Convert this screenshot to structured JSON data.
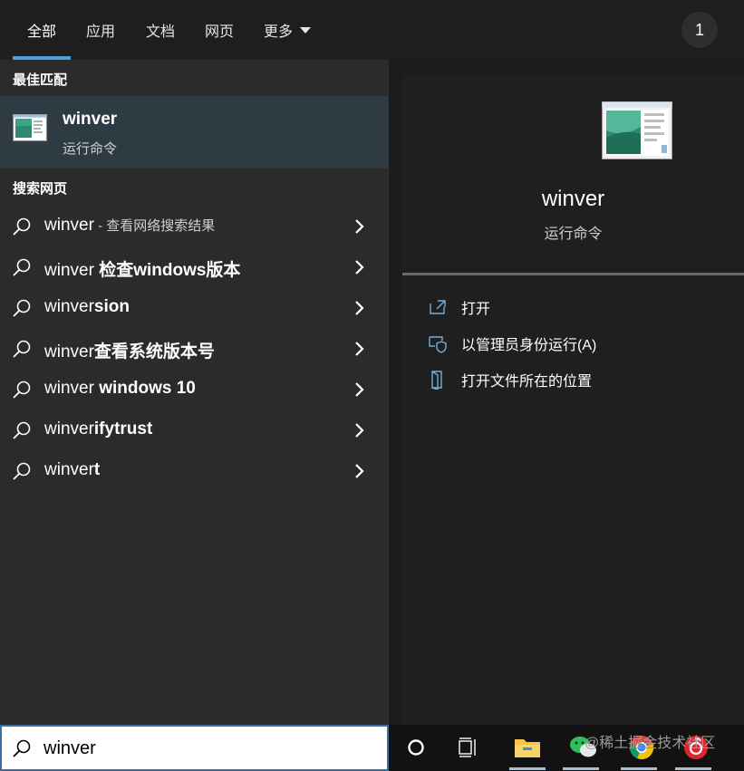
{
  "tabs": [
    {
      "label": "全部",
      "active": true
    },
    {
      "label": "应用"
    },
    {
      "label": "文档"
    },
    {
      "label": "网页"
    },
    {
      "label": "更多"
    }
  ],
  "badge_count": "1",
  "best_match": {
    "section_title": "最佳匹配",
    "name": "winver",
    "subtitle": "运行命令"
  },
  "web_section_title": "搜索网页",
  "suggestions": [
    {
      "prefix": "winver",
      "rest": " - 查看网络搜索结果",
      "rest_style": "small"
    },
    {
      "prefix": "winver ",
      "rest": "检查windows版本",
      "rest_style": "bold"
    },
    {
      "prefix": "winver",
      "rest": "sion",
      "rest_style": "bold"
    },
    {
      "prefix": "winver",
      "rest": "查看系统版本号",
      "rest_style": "bold"
    },
    {
      "prefix": "winver ",
      "rest": "windows 10",
      "rest_style": "bold"
    },
    {
      "prefix": "winver",
      "rest": "ifytrust",
      "rest_style": "bold"
    },
    {
      "prefix": "winver",
      "rest": "t",
      "rest_style": "bold"
    }
  ],
  "detail": {
    "name": "winver",
    "subtitle": "运行命令",
    "actions": [
      {
        "label": "打开",
        "icon": "open-icon"
      },
      {
        "label": "以管理员身份运行(A)",
        "icon": "shield-icon"
      },
      {
        "label": "打开文件所在的位置",
        "icon": "file-location-icon"
      }
    ]
  },
  "search": {
    "value": "winver",
    "icon": "search-icon"
  },
  "taskbar": {
    "items": [
      "cortana-icon",
      "task-view-icon",
      "file-explorer-icon",
      "wechat-icon",
      "chrome-icon",
      "netease-music-icon"
    ]
  },
  "watermark": "@稀土掘金技术社区",
  "colors": {
    "accent": "#4a9fe0",
    "selected_row": "#2f3b42",
    "panel_left": "#2b2b2b",
    "panel_right": "#1f1f1f"
  }
}
